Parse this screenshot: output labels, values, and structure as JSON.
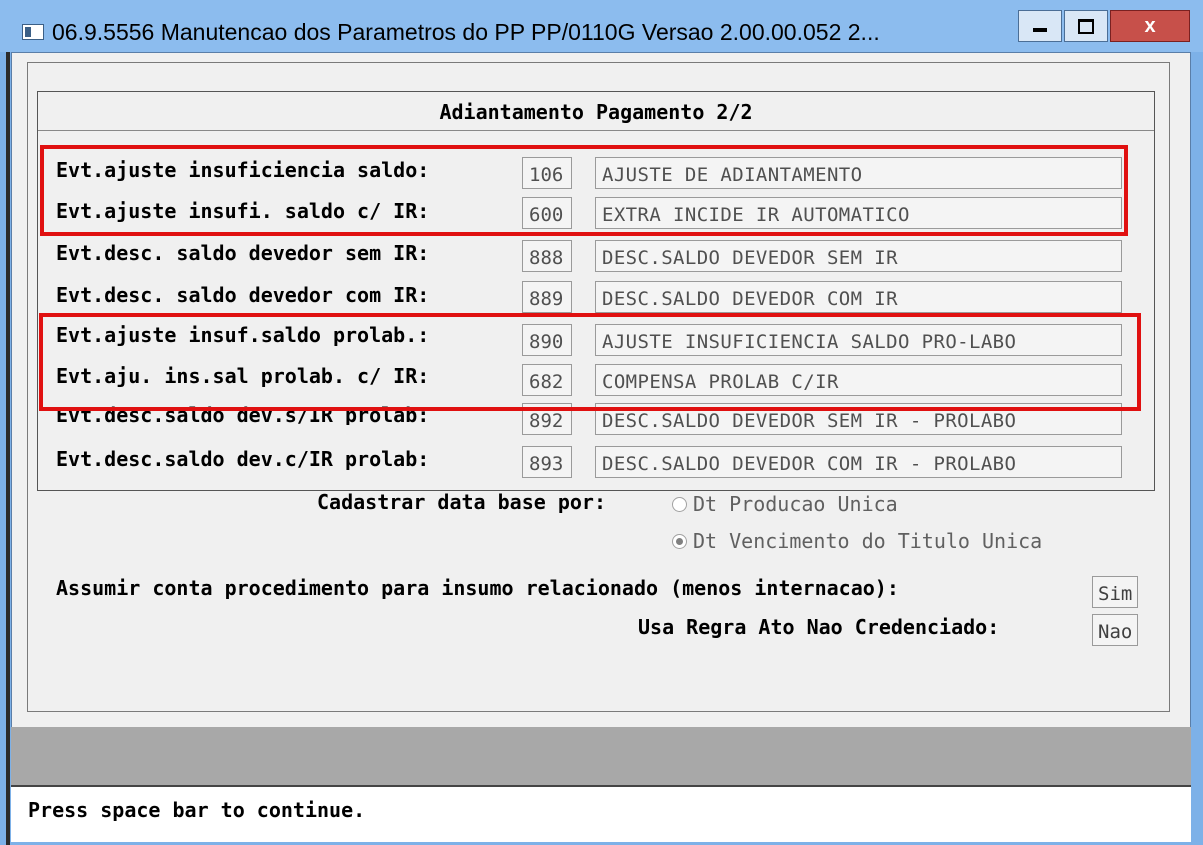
{
  "window": {
    "title": "06.9.5556 Manutencao dos  Parametros do PP PP/0110G Versao 2.00.00.052 2...",
    "close_label": "x"
  },
  "dialog": {
    "title": "Adiantamento Pagamento 2/2",
    "events": [
      {
        "label": "Evt.ajuste insuficiencia saldo:",
        "code": "106",
        "description": "AJUSTE DE ADIANTAMENTO"
      },
      {
        "label": "Evt.ajuste insufi. saldo c/ IR:",
        "code": "600",
        "description": "EXTRA INCIDE IR AUTOMATICO"
      },
      {
        "label": "Evt.desc. saldo devedor sem IR:",
        "code": "888",
        "description": "DESC.SALDO DEVEDOR SEM IR"
      },
      {
        "label": "Evt.desc. saldo devedor com IR:",
        "code": "889",
        "description": "DESC.SALDO DEVEDOR COM IR"
      },
      {
        "label": "Evt.ajuste insuf.saldo prolab.:",
        "code": "890",
        "description": "AJUSTE INSUFICIENCIA SALDO PRO-LABO"
      },
      {
        "label": "Evt.aju. ins.sal prolab. c/ IR:",
        "code": "682",
        "description": "COMPENSA PROLAB C/IR"
      },
      {
        "label": "Evt.desc.saldo dev.s/IR prolab:",
        "code": "892",
        "description": "DESC.SALDO DEVEDOR SEM IR - PROLABO"
      },
      {
        "label": "Evt.desc.saldo dev.c/IR prolab:",
        "code": "893",
        "description": "DESC.SALDO DEVEDOR COM IR - PROLABO"
      }
    ]
  },
  "form": {
    "date_base_label": "Cadastrar data base por:",
    "radio_options": [
      {
        "label": "Dt Producao Unica",
        "selected": false
      },
      {
        "label": "Dt Vencimento do Titulo Unica",
        "selected": true
      }
    ],
    "assumir_label": "Assumir conta procedimento para insumo relacionado (menos internacao):",
    "assumir_value": "Sim",
    "regra_label": "Usa Regra Ato Nao Credenciado:",
    "regra_value": "Nao"
  },
  "status": {
    "message": "Press space bar to continue."
  },
  "colors": {
    "highlight": "#e01010",
    "titlebar": "#8cbcee"
  }
}
